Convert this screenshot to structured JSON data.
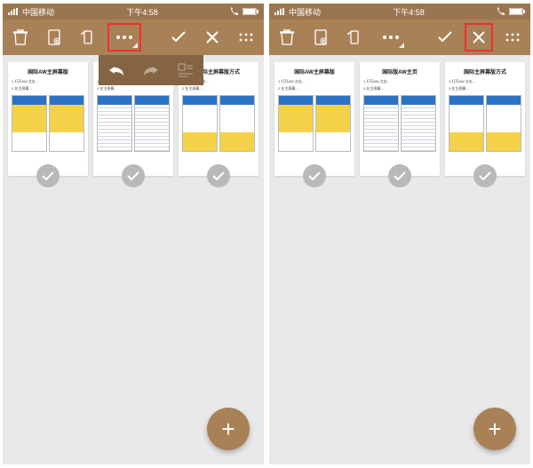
{
  "statusbar": {
    "carrier": "中国移动",
    "time": "下午4:58"
  },
  "toolbar": {
    "icons": [
      "delete",
      "doc",
      "rotate",
      "more",
      "confirm",
      "close",
      "grid"
    ]
  },
  "dropdown": {
    "items": [
      "undo",
      "redo",
      "tools"
    ]
  },
  "cards": [
    {
      "title": "国际AW主屏幕版",
      "line1": "1.打开AW 点击…",
      "line2": "2.在主屏幕…"
    },
    {
      "title": "国际版AW主页",
      "line1": "1.打开AW 点击…",
      "line2": "2.在主屏幕…"
    },
    {
      "title": "国际主屏幕版方式",
      "line1": "1.打开AW 点击…",
      "line2": "2.在主屏幕…"
    }
  ],
  "fab": {
    "label": "+"
  },
  "colors": {
    "brand": "#a98156",
    "brandDark": "#846442",
    "red": "#ec3131"
  }
}
